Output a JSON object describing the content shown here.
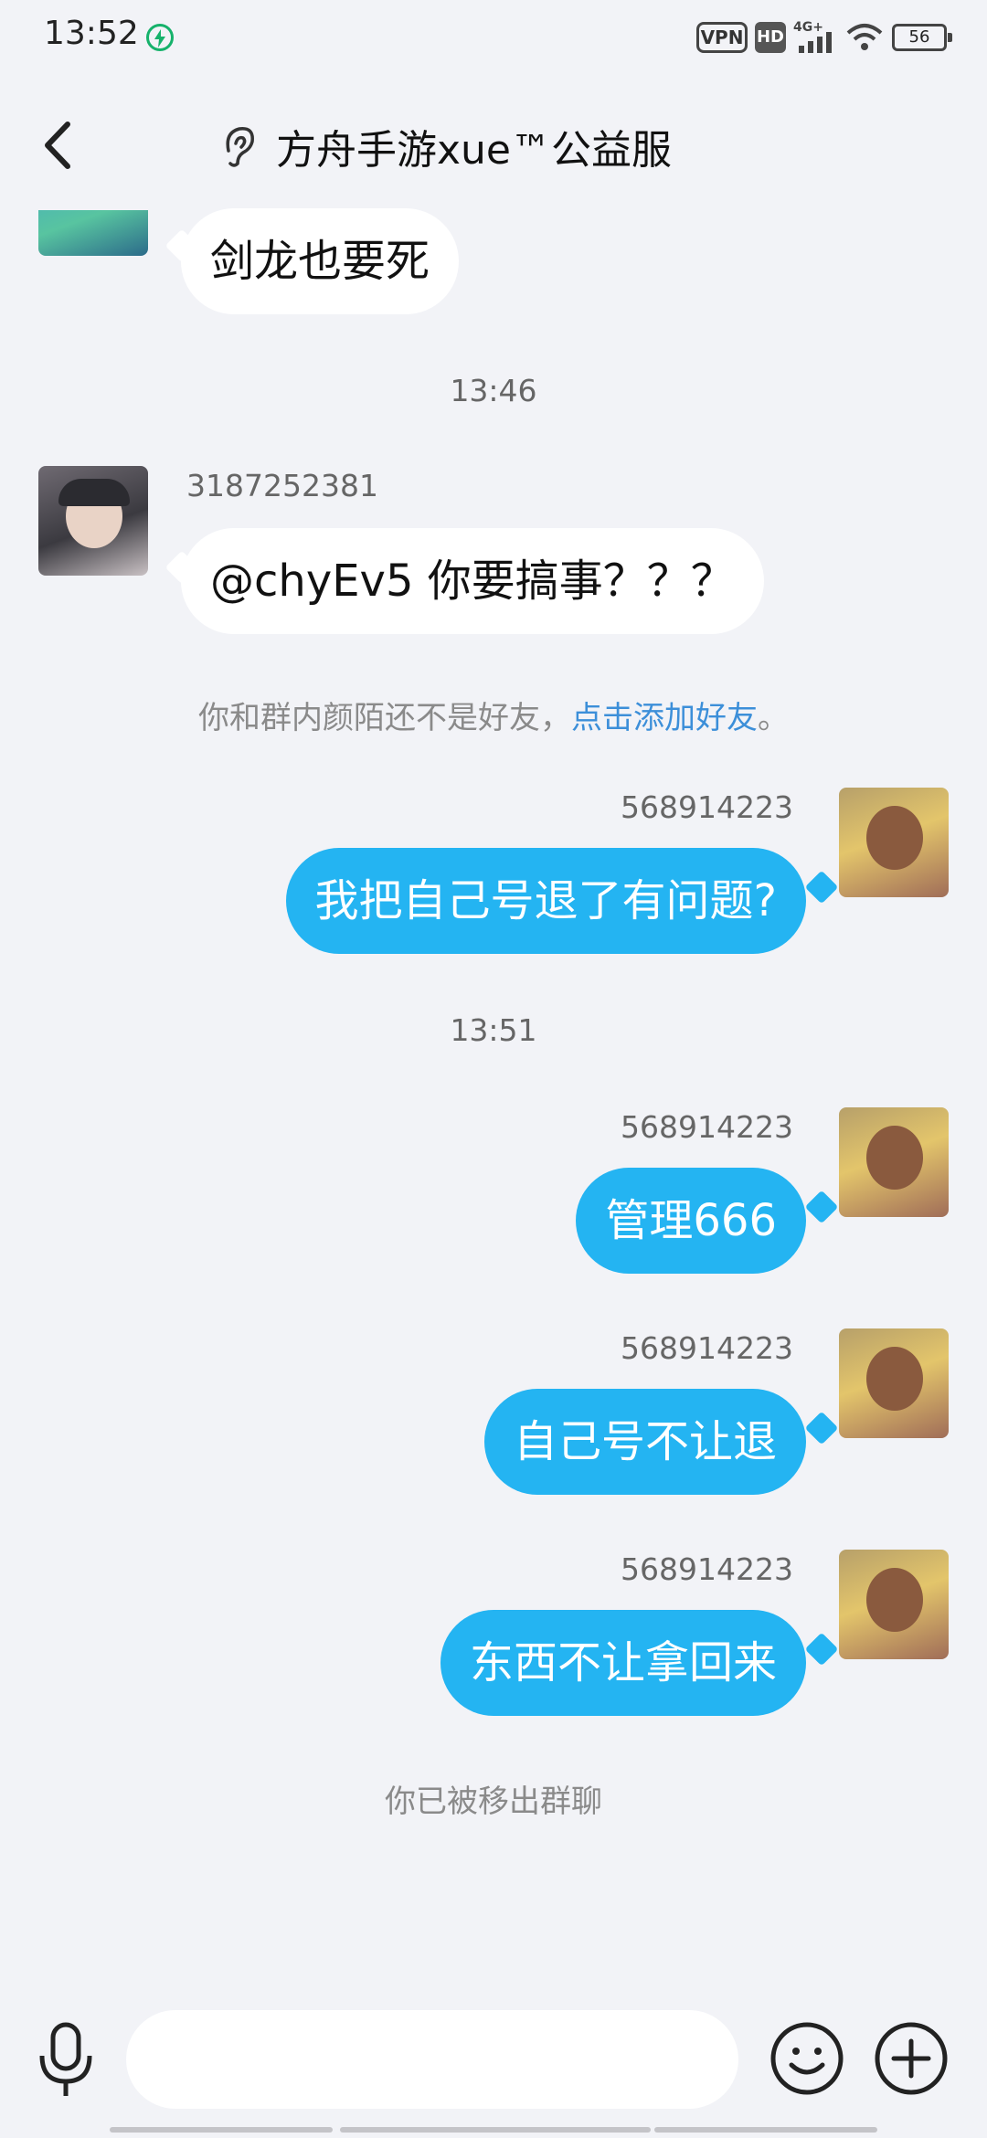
{
  "status_bar": {
    "time": "13:52",
    "vpn": "VPN",
    "hd": "HD",
    "network": "4G+",
    "battery": "56"
  },
  "header": {
    "title": "方舟手游xue™公益服"
  },
  "messages": {
    "m0": {
      "text": "剑龙也要死"
    },
    "t1": "13:46",
    "m1": {
      "sender": "3187252381",
      "text": "@chyEv5   你要搞事？？？"
    },
    "notice": {
      "text": "你和群内颜陌还不是好友，",
      "link": "点击添加好友",
      "end": "。"
    },
    "m2": {
      "sender": "568914223",
      "text": "我把自己号退了有问题?"
    },
    "t2": "13:51",
    "m3": {
      "sender": "568914223",
      "text": "管理666"
    },
    "m4": {
      "sender": "568914223",
      "text": "自己号不让退"
    },
    "m5": {
      "sender": "568914223",
      "text": "东西不让拿回来"
    },
    "removed": "你已被移出群聊"
  },
  "input": {
    "placeholder": ""
  },
  "colors": {
    "outgoing_bubble": "#24b4f2",
    "background": "#f2f3f7",
    "link": "#3c8fd9"
  }
}
